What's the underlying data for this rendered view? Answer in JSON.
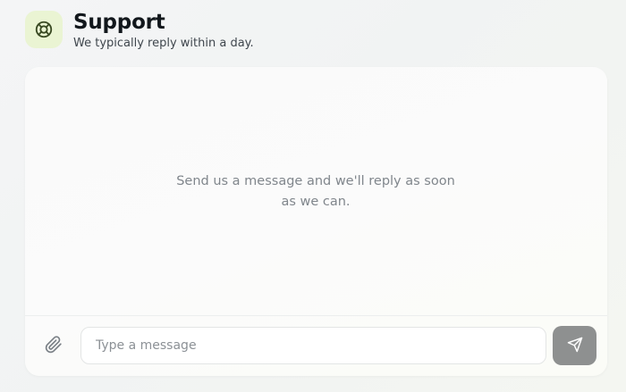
{
  "header": {
    "title": "Support",
    "subtitle": "We typically reply within a day.",
    "icon": "lifebuoy-icon",
    "icon_bg": "#eaf4d3",
    "icon_color": "#3a4a23"
  },
  "chat": {
    "empty_message": "Send us a message and we'll reply as soon as we can."
  },
  "composer": {
    "attach_icon": "paperclip-icon",
    "input_value": "",
    "input_placeholder": "Type a message",
    "send_icon": "send-icon",
    "send_button_color": "#8e9090"
  }
}
